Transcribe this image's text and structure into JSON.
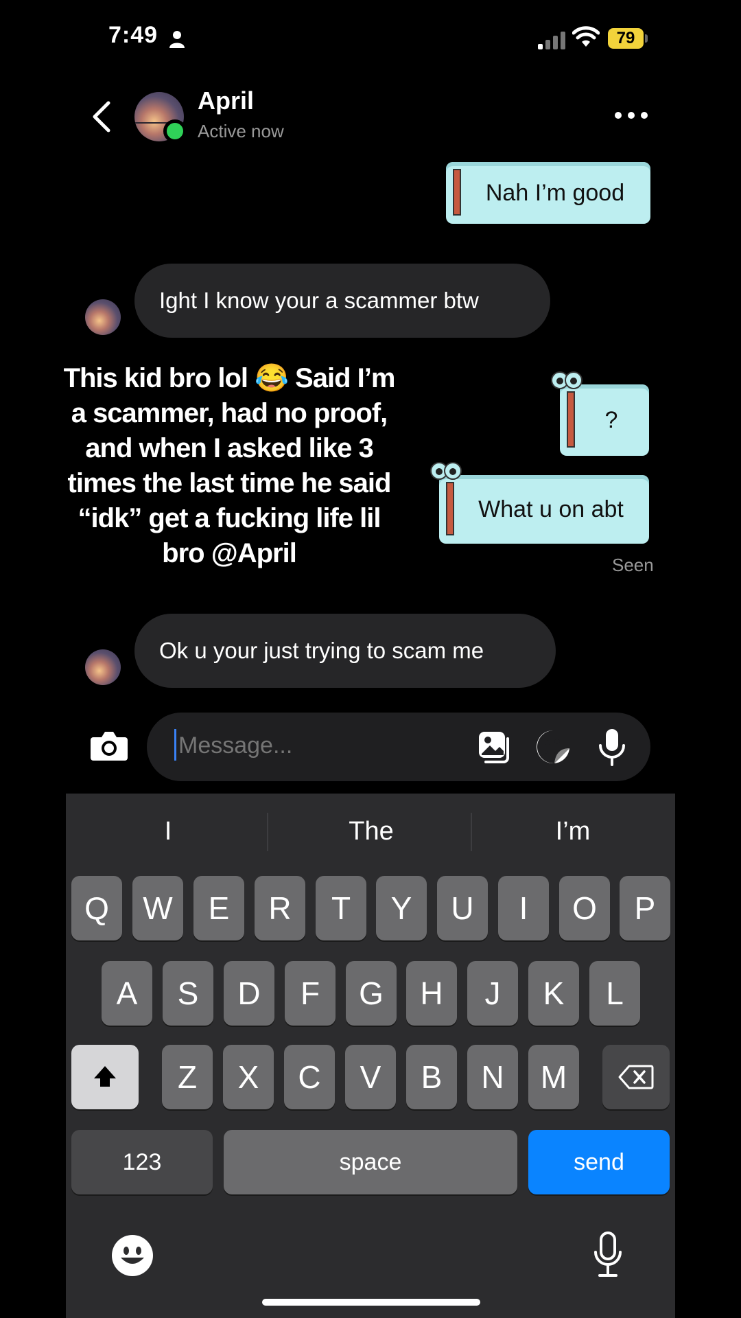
{
  "status_bar": {
    "time": "7:49",
    "battery": "79"
  },
  "header": {
    "contact_name": "April",
    "contact_status": "Active now"
  },
  "messages": {
    "sent_1": "Nah I’m good",
    "received_1": "Ight I know your a scammer btw",
    "sent_2": "?",
    "sent_3": "What u on abt",
    "seen": "Seen",
    "received_2": "Ok u your just trying to scam me"
  },
  "overlay_caption": "This kid bro lol 😂 Said I’m a scammer, had no proof, and when I asked like 3 times the last time he said “idk” get a fucking life lil bro @April",
  "composer": {
    "placeholder": "Message..."
  },
  "keyboard": {
    "suggestions": [
      "I",
      "The",
      "I’m"
    ],
    "row1": [
      "Q",
      "W",
      "E",
      "R",
      "T",
      "Y",
      "U",
      "I",
      "O",
      "P"
    ],
    "row2": [
      "A",
      "S",
      "D",
      "F",
      "G",
      "H",
      "J",
      "K",
      "L"
    ],
    "row3": [
      "Z",
      "X",
      "C",
      "V",
      "B",
      "N",
      "M"
    ],
    "numbers_label": "123",
    "space_label": "space",
    "send_label": "send"
  },
  "icons": {
    "back": "chevron-left-icon",
    "more": "more-dots-icon",
    "camera": "camera-icon",
    "gallery": "gallery-icon",
    "sticker": "sticker-icon",
    "mic": "microphone-icon",
    "shift": "shift-icon",
    "delete": "backspace-icon",
    "emoji": "emoji-icon"
  },
  "colors": {
    "accent": "#0a84ff",
    "online": "#2fd158",
    "sticker_bg": "#bdeef0",
    "received_bubble": "#262628"
  }
}
